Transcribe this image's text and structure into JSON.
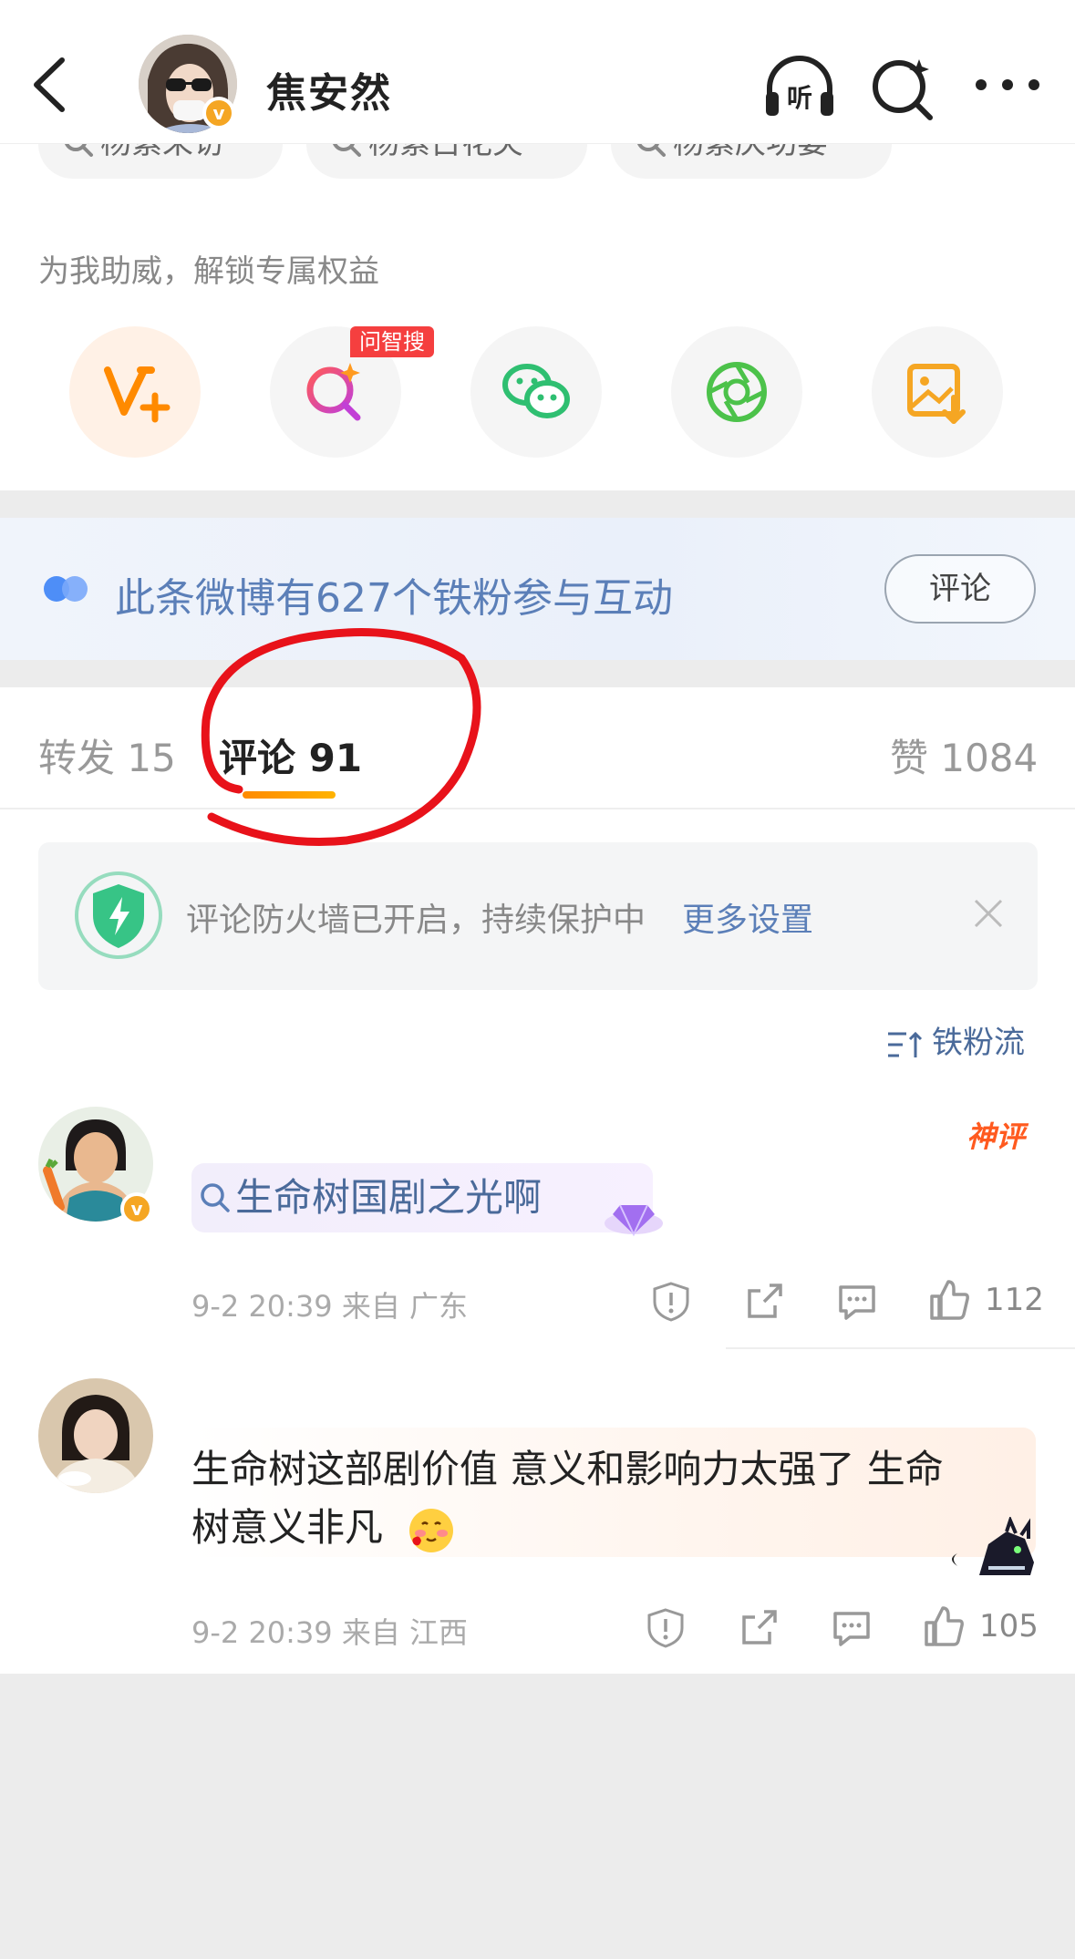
{
  "header": {
    "user_name": "焦安然",
    "listen_label": "听"
  },
  "top_tags": [
    "杨紫采访",
    "杨紫古花夹",
    "杨紫庆功宴"
  ],
  "boost": {
    "label": "为我助威，解锁专属权益",
    "actions": [
      {
        "icon": "v-plus-icon"
      },
      {
        "icon": "ai-search-icon",
        "badge": "问智搜"
      },
      {
        "icon": "wechat-icon"
      },
      {
        "icon": "moments-icon"
      },
      {
        "icon": "save-image-icon"
      }
    ]
  },
  "fans_banner": {
    "text": "此条微博有627个铁粉参与互动",
    "button": "评论"
  },
  "tabs": {
    "repost": "转发 15",
    "comments": "评论 91",
    "likes": "赞 1084"
  },
  "firewall": {
    "text": "评论防火墙已开启，持续保护中",
    "link": "更多设置"
  },
  "sort_label": "铁粉流",
  "comments": [
    {
      "text": "生命树国剧之光啊",
      "badge": "神评",
      "time": "9-2 20:39 来自 广东",
      "likes": "112"
    },
    {
      "text_line1": "生命树这部剧价值 意义和影响力太强了 生命",
      "text_line2": "树意义非凡",
      "time": "9-2 20:39 来自 江西",
      "likes": "105"
    }
  ],
  "colors": {
    "brand_orange": "#ff8a00",
    "link_blue": "#5b7fb8",
    "annotation_red": "#e8121a"
  }
}
